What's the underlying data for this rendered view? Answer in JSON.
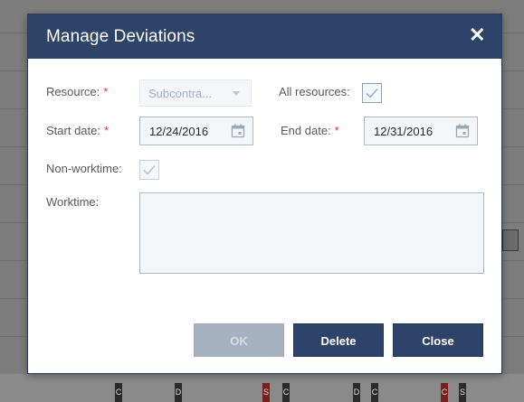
{
  "dialog": {
    "title": "Manage Deviations",
    "close_label": "✕"
  },
  "form": {
    "resource": {
      "label": "Resource:",
      "required_mark": "*",
      "value": "Subcontra..."
    },
    "all_resources": {
      "label": "All resources:",
      "checked": true
    },
    "start_date": {
      "label": "Start date:",
      "required_mark": "*",
      "value": "12/24/2016"
    },
    "end_date": {
      "label": "End date:",
      "required_mark": "*",
      "value": "12/31/2016"
    },
    "non_worktime": {
      "label": "Non-worktime:",
      "checked": true
    },
    "worktime": {
      "label": "Worktime:",
      "value": ""
    }
  },
  "buttons": {
    "ok": "OK",
    "delete": "Delete",
    "close": "Close"
  },
  "background": {
    "chips": [
      "C",
      "D",
      "S",
      "C",
      "D",
      "C",
      "C",
      "S"
    ]
  },
  "colors": {
    "header": "#2d4468",
    "required": "#d9363e",
    "primary_button": "#2d4468",
    "disabled_button": "#a6b1bf"
  }
}
